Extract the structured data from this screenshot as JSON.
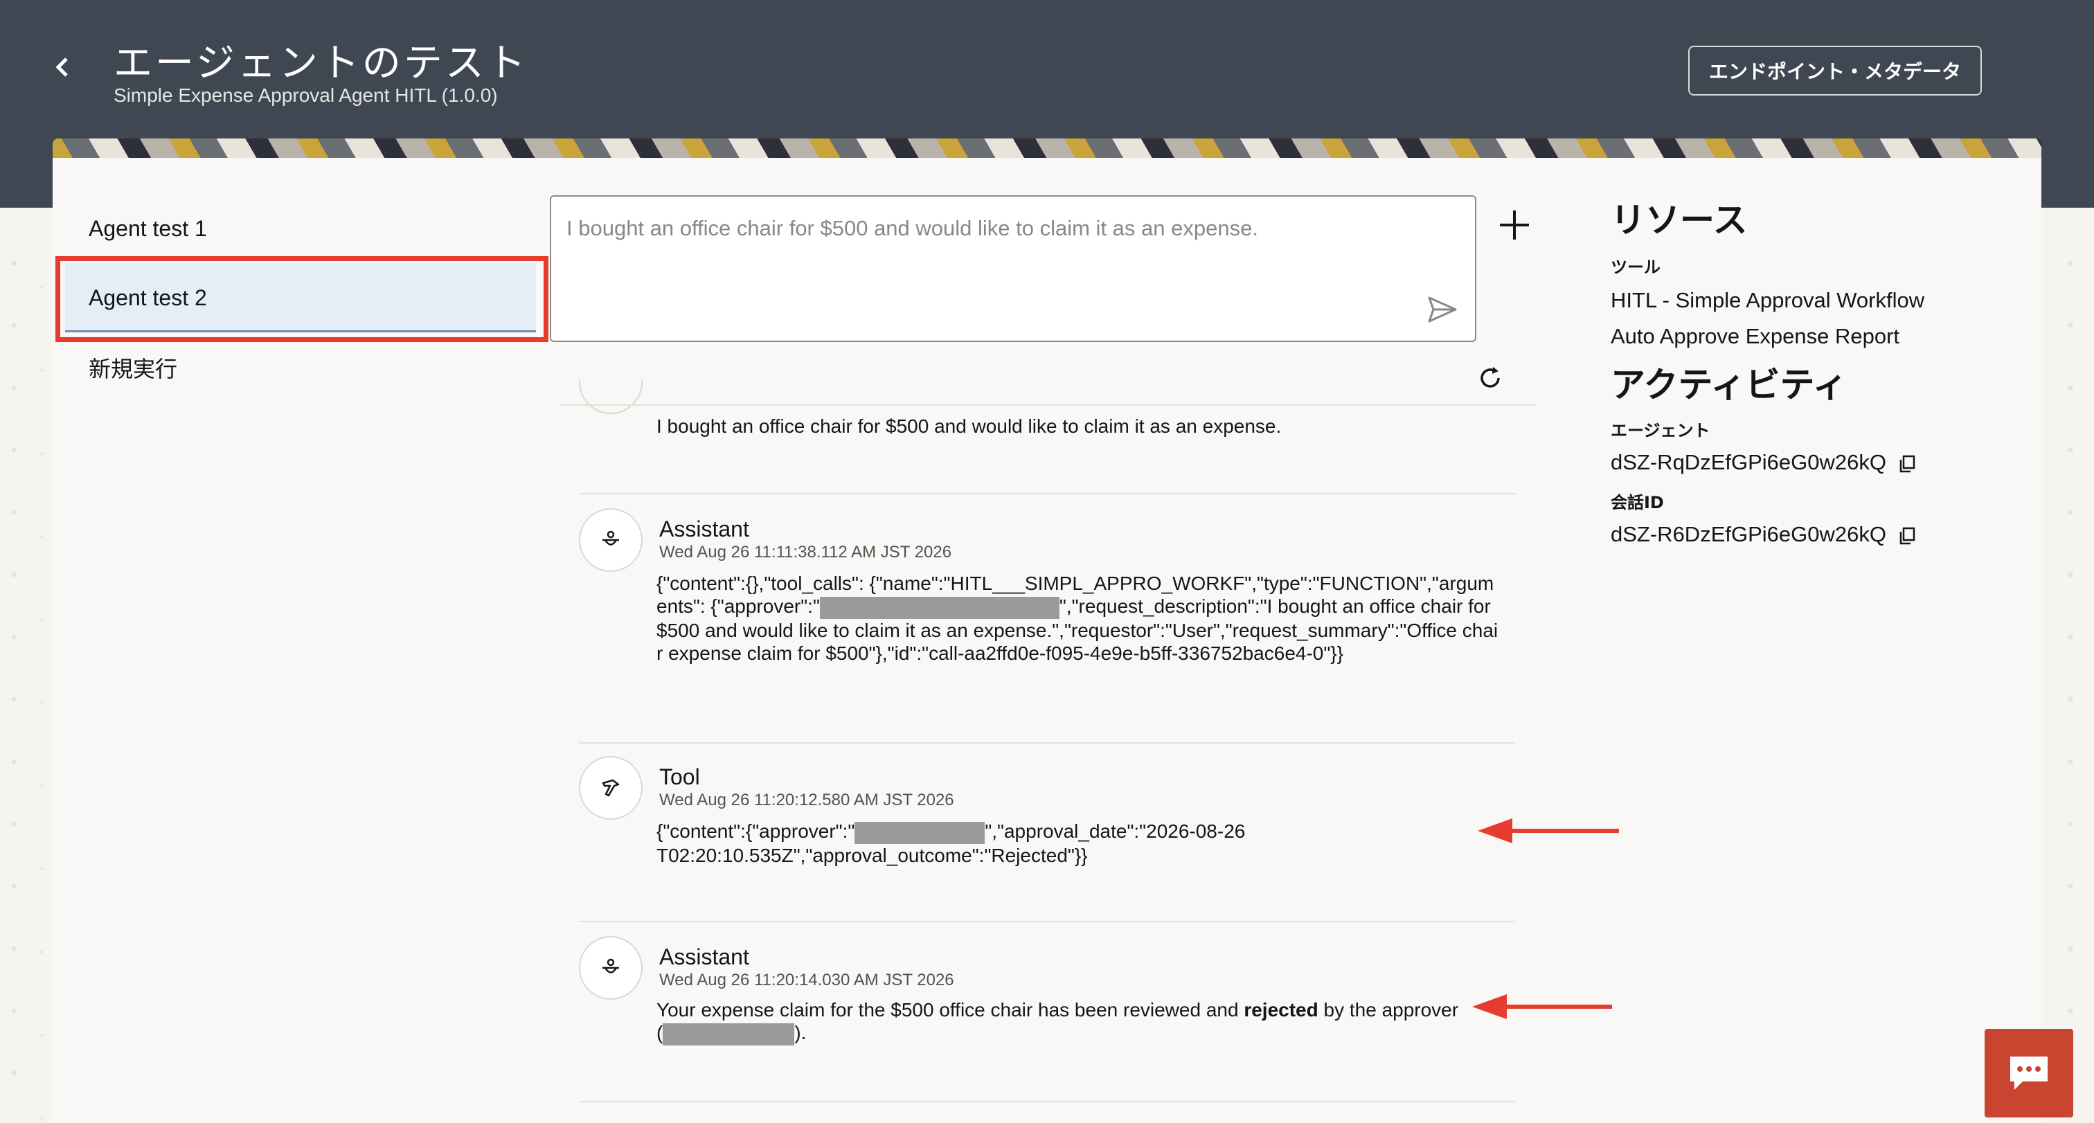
{
  "header": {
    "title": "エージェントのテスト",
    "subtitle": "Simple Expense Approval Agent HITL (1.0.0)",
    "endpoint_button": "エンドポイント・メタデータ"
  },
  "sidebar": {
    "items": [
      {
        "label": "Agent test 1"
      },
      {
        "label": "Agent test 2",
        "selected": true
      }
    ],
    "new_run": "新規実行"
  },
  "prompt": {
    "placeholder": "I bought an office chair for $500 and would like to claim it as an expense."
  },
  "messages": {
    "user_text": "I bought an office chair for $500 and would like to claim it as an expense.",
    "assistant1": {
      "role": "Assistant",
      "time": "Wed Aug 26 11:11:38.112 AM JST 2026",
      "body_part1": "{\"content\":{},\"tool_calls\": {\"name\":\"HITL___SIMPL_APPRO_WORKF\",\"type\":\"FUNCTION\",\"arguments\": {\"approver\":\"",
      "body_part2": "\",\"request_description\":\"I bought an office chair for $500 and would like to claim it as an expense.\",\"requestor\":\"User\",\"request_summary\":\"Office chair expense claim for $500\"},\"id\":\"call-aa2ffd0e-f095-4e9e-b5ff-336752bac6e4-0\"}}"
    },
    "tool": {
      "role": "Tool",
      "time": "Wed Aug 26 11:20:12.580 AM JST 2026",
      "body_part1": "{\"content\":{\"approver\":\"",
      "body_part2": "\",\"approval_date\":\"2026-08-26T02:20:10.535Z\",\"approval_outcome\":\"Rejected\"}}"
    },
    "assistant2": {
      "role": "Assistant",
      "time": "Wed Aug 26 11:20:14.030 AM JST 2026",
      "body_part1": "Your expense claim for the $500 office chair has been reviewed and ",
      "body_bold": "rejected",
      "body_part2": " by the approver",
      "body_open": "(",
      "body_close": ")."
    }
  },
  "resources": {
    "heading": "リソース",
    "tools_label": "ツール",
    "tools": [
      "HITL - Simple Approval Workflow",
      "Auto Approve Expense Report"
    ],
    "activity_heading": "アクティビティ",
    "agent_label": "エージェント",
    "agent_id": "dSZ-RqDzEfGPi6eG0w26kQ",
    "conversation_label": "会話ID",
    "conversation_id": "dSZ-R6DzEfGPi6eG0w26kQ"
  },
  "colors": {
    "header_bg": "#3f4752",
    "highlight_outline": "#e63b2e",
    "selected_bg": "#e4eef7",
    "chat_fab": "#c9452f"
  },
  "icons": [
    "back-chevron-icon",
    "send-icon",
    "plus-icon",
    "refresh-icon",
    "assistant-icon",
    "tool-icon",
    "copy-icon",
    "chat-icon",
    "arrow-left-icon"
  ]
}
